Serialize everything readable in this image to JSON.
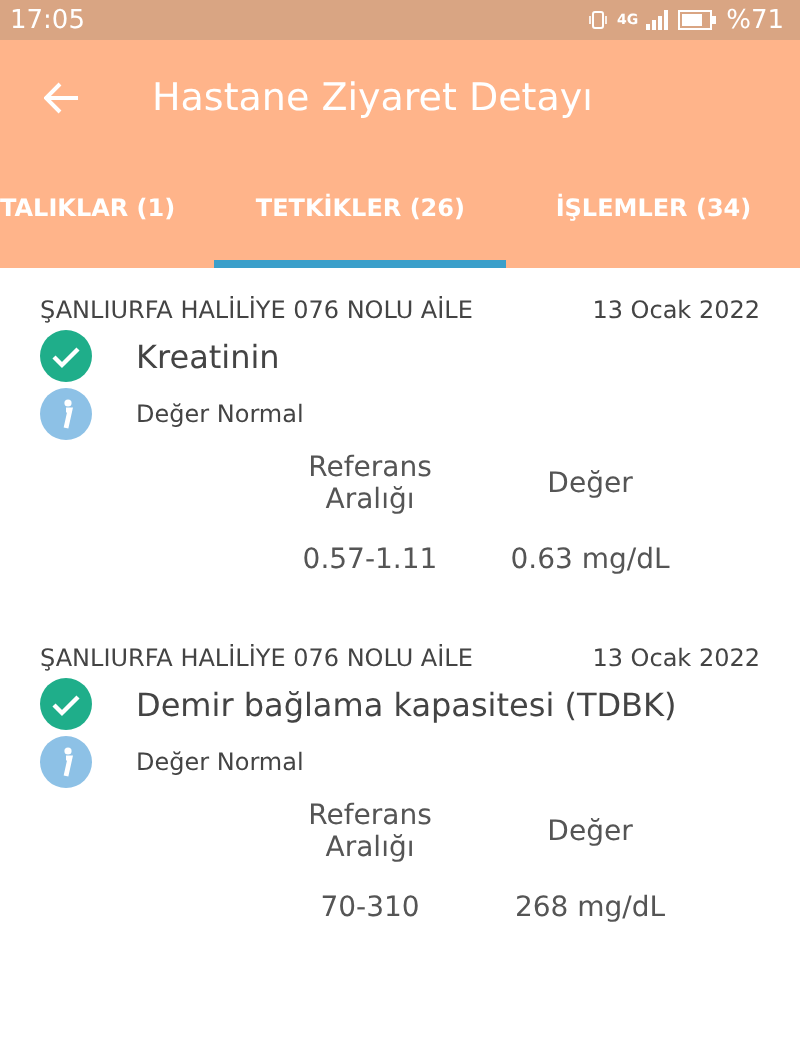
{
  "status_bar": {
    "time": "17:05",
    "network": "4G",
    "battery": "%71"
  },
  "app_bar": {
    "title": "Hastane Ziyaret Detayı"
  },
  "tabs": [
    {
      "label": "TALIKLAR (1)",
      "selected": false
    },
    {
      "label": "TETKİKLER (26)",
      "selected": true
    },
    {
      "label": "İŞLEMLER (34)",
      "selected": false
    }
  ],
  "results": [
    {
      "facility": "ŞANLIURFA HALİLİYE 076 NOLU AİLE",
      "date": "13 Ocak 2022",
      "test": "Kreatinin",
      "status": "Değer Normal",
      "reference_header": "Referans Aralığı",
      "value_header": "Değer",
      "reference": "0.57-1.11",
      "value": "0.63 mg/dL"
    },
    {
      "facility": "ŞANLIURFA HALİLİYE 076 NOLU AİLE",
      "date": "13 Ocak 2022",
      "test": "Demir bağlama kapasitesi (TDBK)",
      "status": "Değer Normal",
      "reference_header": "Referans Aralığı",
      "value_header": "Değer",
      "reference": "70-310",
      "value": "268 mg/dL"
    }
  ]
}
